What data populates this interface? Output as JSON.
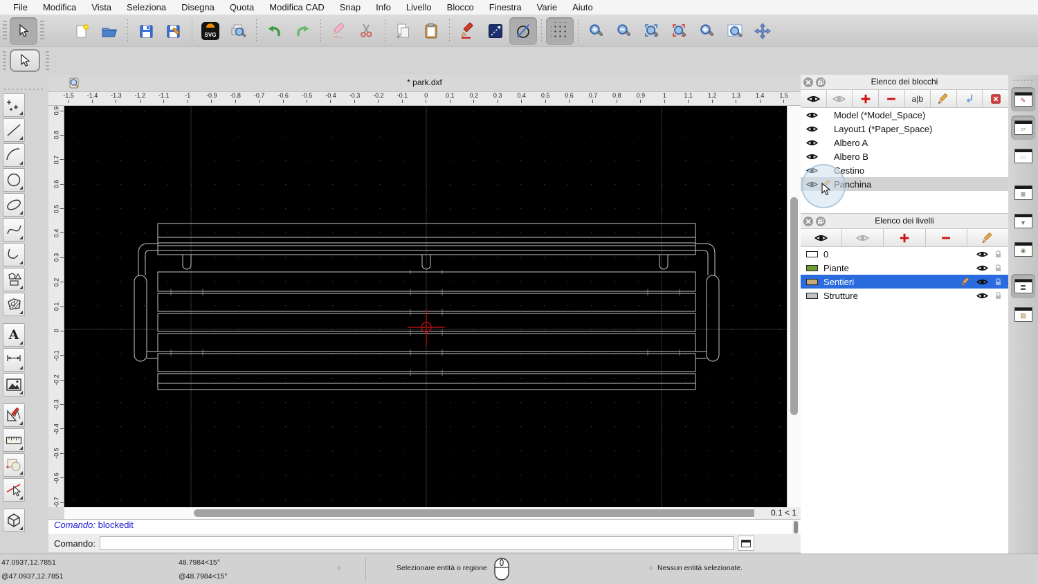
{
  "menu": {
    "items": [
      "File",
      "Modifica",
      "Vista",
      "Seleziona",
      "Disegna",
      "Quota",
      "Modifica CAD",
      "Snap",
      "Info",
      "Livello",
      "Blocco",
      "Finestra",
      "Varie",
      "Aiuto"
    ]
  },
  "toolbar": {
    "svg_label": "SVG",
    "icons": [
      "selection-arrow",
      "new-document",
      "open-folder",
      "save",
      "save-as",
      "svg-export",
      "print-preview",
      "undo",
      "redo",
      "delete-eraser",
      "cut-scissors",
      "copy",
      "paste",
      "draw-pen",
      "line-tool",
      "circle-slash-tool",
      "grid-toggle",
      "zoom-in",
      "zoom-out",
      "auto-zoom",
      "zoom-selection",
      "previous-view",
      "zoom-window",
      "auto-pan"
    ]
  },
  "palette": {
    "text_tool_glyph": "A",
    "icons": [
      "points",
      "line",
      "arc",
      "circle",
      "ellipse",
      "spline",
      "polyline",
      "shape",
      "hatch",
      "text",
      "dimension",
      "image",
      "modify",
      "measure",
      "block",
      "modify-selection",
      "solid-3d"
    ]
  },
  "document": {
    "tab_title": "* park.dxf",
    "grid_indicator": "0.1 < 1"
  },
  "rulers": {
    "horizontal": [
      "-1.5",
      "-1.4",
      "-1.3",
      "-1.2",
      "-1.1",
      "-1",
      "-0.9",
      "-0.8",
      "-0.7",
      "-0.6",
      "-0.5",
      "-0.4",
      "-0.3",
      "-0.2",
      "-0.1",
      "0",
      "0.1",
      "0.2",
      "0.3",
      "0.4",
      "0.5",
      "0.6",
      "0.7",
      "0.8",
      "0.9",
      "1",
      "1.1",
      "1.2",
      "1.3",
      "1.4",
      "1.5"
    ],
    "vertical": [
      "0.9",
      "0.8",
      "0.7",
      "0.6",
      "0.5",
      "0.4",
      "0.3",
      "0.2",
      "0.1",
      "0",
      "-0.1",
      "-0.2",
      "-0.3",
      "-0.4",
      "-0.5",
      "-0.6",
      "-0.7"
    ]
  },
  "blocks_panel": {
    "title": "Elenco dei blocchi",
    "rename_label": "a|b",
    "items": [
      {
        "name": "Model (*Model_Space)",
        "state": "normal",
        "editing": false
      },
      {
        "name": "Layout1 (*Paper_Space)",
        "state": "normal",
        "editing": false
      },
      {
        "name": "Albero A",
        "state": "normal",
        "editing": false
      },
      {
        "name": "Albero B",
        "state": "normal",
        "editing": false
      },
      {
        "name": "Cestino",
        "state": "normal",
        "editing": false
      },
      {
        "name": "Panchina",
        "state": "selected",
        "editing": true
      }
    ]
  },
  "layers_panel": {
    "title": "Elenco dei livelli",
    "items": [
      {
        "name": "0",
        "color": "#ffffff",
        "state": "normal",
        "editing": false
      },
      {
        "name": "Piante",
        "color": "#6d9e33",
        "state": "normal",
        "editing": false
      },
      {
        "name": "Sentieri",
        "color": "#c9aa7d",
        "state": "selected",
        "editing": true
      },
      {
        "name": "Strutture",
        "color": "#c2c2c2",
        "state": "normal",
        "editing": false
      }
    ]
  },
  "dock": {
    "items": [
      {
        "name": "layer-list-panel",
        "kind": "pencil-window",
        "pressed": true
      },
      {
        "name": "block-list-panel",
        "kind": "shapes-window",
        "pressed": true
      },
      {
        "name": "library-browser-panel",
        "kind": "plain-window",
        "pressed": false
      },
      {
        "name": "property-editor-panel",
        "kind": "list-window",
        "pressed": false
      },
      {
        "name": "selection-filter-panel",
        "kind": "funnel-window",
        "pressed": false
      },
      {
        "name": "view-options-panel",
        "kind": "object-window",
        "pressed": false
      },
      {
        "name": "command-line-panel",
        "kind": "command-window",
        "pressed": true
      },
      {
        "name": "clipboard-panel",
        "kind": "clipboard-window",
        "pressed": false
      }
    ]
  },
  "command": {
    "history_label": "Comando:",
    "history_value": "blockedit",
    "input_label": "Comando:",
    "input_value": "",
    "accent": "#1b1bd1"
  },
  "statusbar": {
    "abs_coord": "47.0937,12.7851",
    "rel_coord": "@47.0937,12.7851",
    "abs_polar": "48.7984<15°",
    "rel_polar": "@48.7984<15°",
    "hint": "Selezionare entità o regione",
    "selection_status": "Nessun entità selezionate."
  },
  "canvas": {
    "bg": "#000000",
    "origin_color": "#b01010",
    "line_color": "#c9c9c9",
    "grid_color": "#3c3c3c"
  }
}
